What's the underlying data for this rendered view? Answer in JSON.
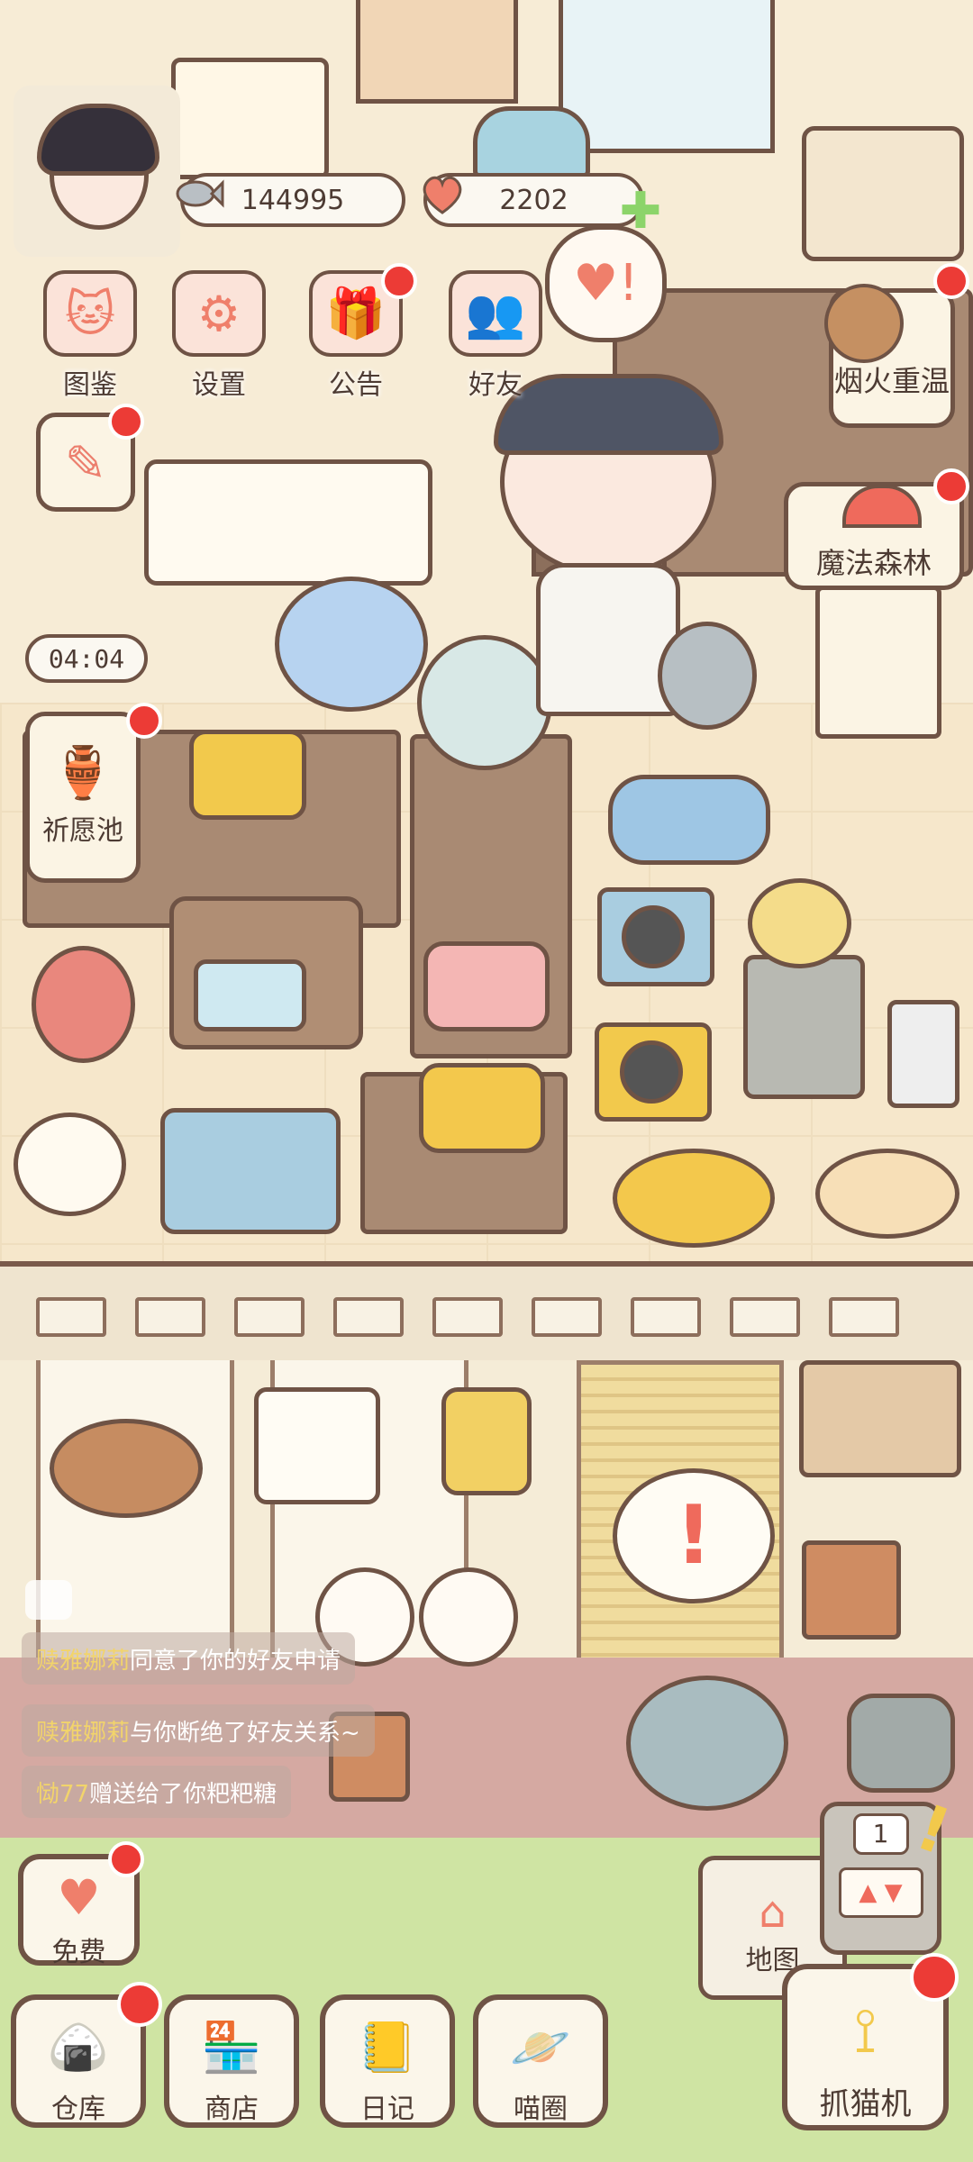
{
  "resources": {
    "fish": {
      "icon": "fish-icon",
      "value": "144995"
    },
    "heart": {
      "icon": "heart-icon",
      "value": "2202"
    }
  },
  "top_menu": [
    {
      "key": "collection",
      "label": "图鉴",
      "icon": "cat-head-icon",
      "badge": false
    },
    {
      "key": "settings",
      "label": "设置",
      "icon": "gear-icon",
      "badge": false
    },
    {
      "key": "notice",
      "label": "公告",
      "icon": "gift-icon",
      "badge": true
    },
    {
      "key": "friends",
      "label": "好友",
      "icon": "friends-icon",
      "badge": false
    }
  ],
  "events": {
    "fireworks": {
      "label": "烟火重温",
      "icon": "panda-bear-icon"
    },
    "magic_forest": {
      "label": "魔法森林",
      "icon": "mushroom-icon"
    }
  },
  "wishing_pool": {
    "label": "祈愿池",
    "icon": "fountain-icon",
    "timer": "04:04"
  },
  "feed": [
    {
      "name": "赎雅娜莉",
      "text": "同意了你的好友申请"
    },
    {
      "name": "赎雅娜莉",
      "text": "与你断绝了好友关系~"
    },
    {
      "name": "恸77",
      "text": "赠送给了你粑粑糖"
    }
  ],
  "free_button": {
    "label": "免费",
    "icon": "heart-bag-icon"
  },
  "slot_count": "1",
  "map_button": {
    "label": "地图",
    "icon": "house-icon"
  },
  "bottom_nav": [
    {
      "key": "warehouse",
      "label": "仓库",
      "icon": "rice-ball-icon",
      "badge": true
    },
    {
      "key": "shop",
      "label": "商店",
      "icon": "shop-icon",
      "badge": false
    },
    {
      "key": "diary",
      "label": "日记",
      "icon": "notebook-icon",
      "badge": false
    },
    {
      "key": "cat_circle",
      "label": "喵圈",
      "icon": "planet-cat-icon",
      "badge": false
    }
  ],
  "claw_machine": {
    "label": "抓猫机",
    "icon": "claw-icon",
    "badge": true
  },
  "colors": {
    "badge": "#ec3b36",
    "accent": "#ef7f6b",
    "outline": "#6f5345",
    "grass": "#cfe4a3"
  }
}
